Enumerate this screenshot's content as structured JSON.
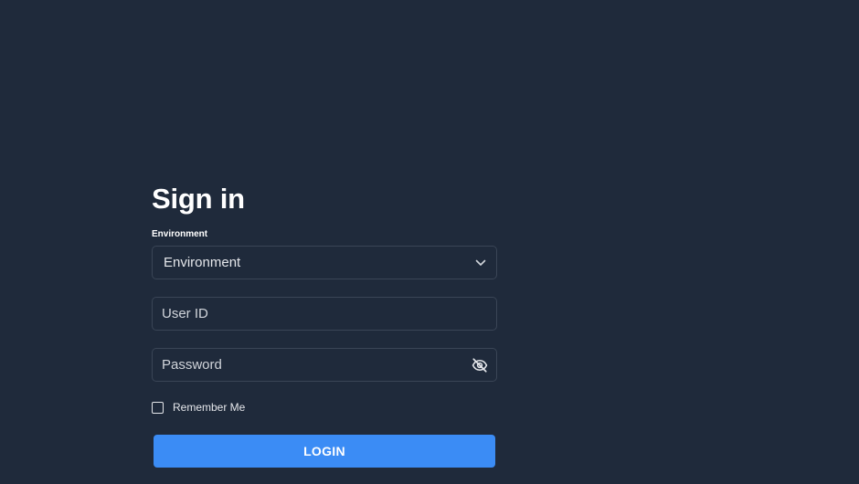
{
  "signin": {
    "title": "Sign in",
    "environment_label": "Environment",
    "environment_value": "Environment",
    "userid_placeholder": "User ID",
    "password_placeholder": "Password",
    "remember_label": "Remember Me",
    "remember_checked": false,
    "login_label": "LOGIN"
  },
  "icons": {
    "select": "chevron-down-icon",
    "password_toggle": "eye-off-icon"
  },
  "colors": {
    "background": "#1f2a3b",
    "field_border": "#3a4556",
    "primary_button": "#3b8cf5",
    "text": "#ffffff"
  }
}
